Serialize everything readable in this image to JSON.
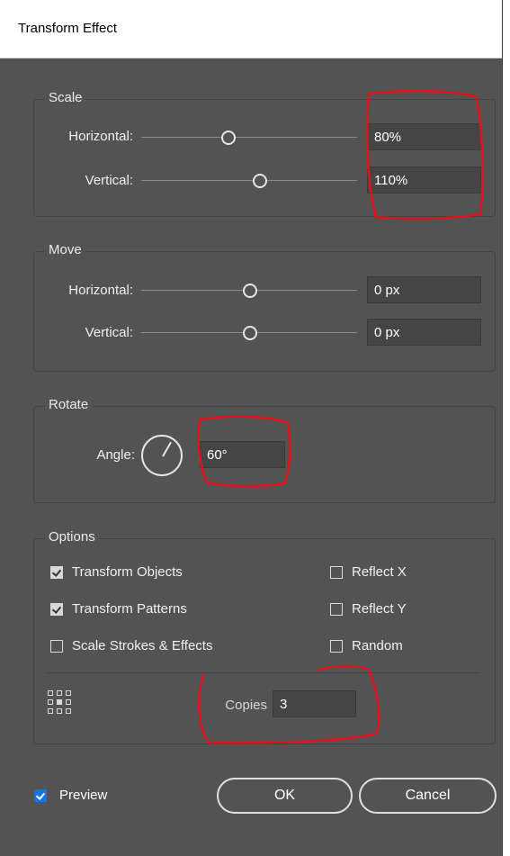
{
  "window": {
    "title": "Transform Effect"
  },
  "scale": {
    "group_title": "Scale",
    "horizontal_label": "Horizontal:",
    "horizontal_value": "80%",
    "vertical_label": "Vertical:",
    "vertical_value": "110%"
  },
  "move": {
    "group_title": "Move",
    "horizontal_label": "Horizontal:",
    "horizontal_value": "0 px",
    "vertical_label": "Vertical:",
    "vertical_value": "0 px"
  },
  "rotate": {
    "group_title": "Rotate",
    "angle_label": "Angle:",
    "angle_value": "60°"
  },
  "options": {
    "group_title": "Options",
    "transform_objects": "Transform Objects",
    "transform_patterns": "Transform Patterns",
    "scale_strokes": "Scale Strokes & Effects",
    "reflect_x": "Reflect X",
    "reflect_y": "Reflect Y",
    "random": "Random",
    "copies_label": "Copies",
    "copies_value": "3"
  },
  "footer": {
    "preview_label": "Preview",
    "ok_label": "OK",
    "cancel_label": "Cancel"
  },
  "colors": {
    "panel_bg": "#535353",
    "annotation_red": "#e0131d",
    "preview_check_blue": "#1473e6"
  },
  "icons": {
    "angle_dial": "dial-icon",
    "reference_point": "reference-point-grid-icon"
  }
}
